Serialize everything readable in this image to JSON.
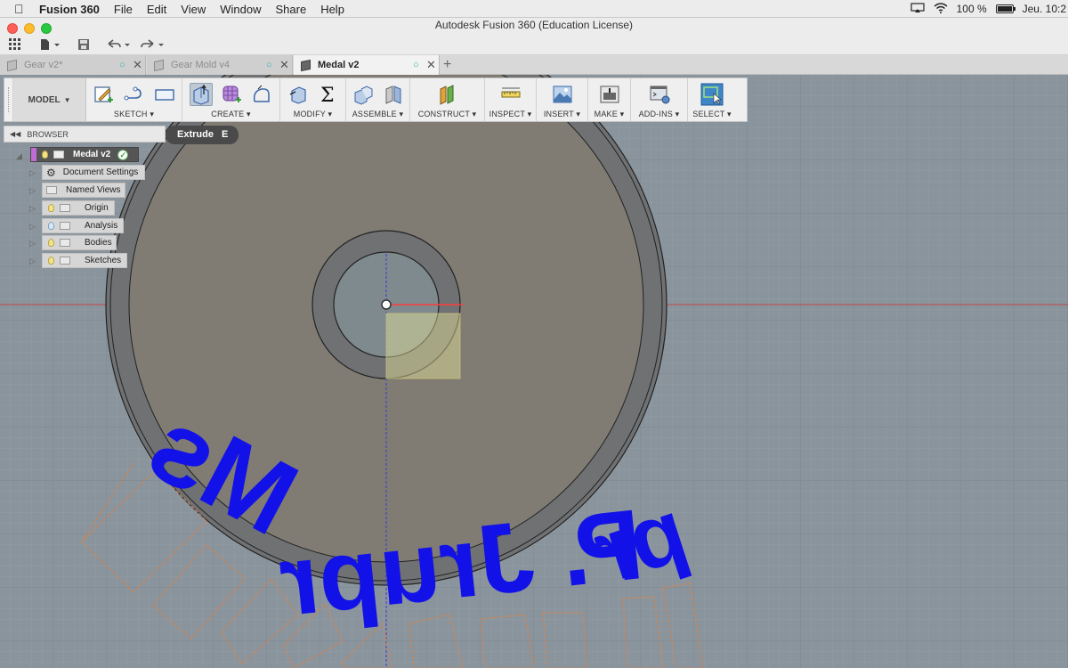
{
  "menubar": {
    "app_name": "Fusion 360",
    "menus": [
      "File",
      "Edit",
      "View",
      "Window",
      "Share",
      "Help"
    ],
    "battery": "100 %",
    "clock": "Jeu. 10:2"
  },
  "window": {
    "title": "Autodesk Fusion 360 (Education License)"
  },
  "tabs": [
    {
      "label": "Gear v2*"
    },
    {
      "label": "Gear Mold v4"
    },
    {
      "label": "Medal v2"
    }
  ],
  "toolbar": {
    "workspace": "MODEL",
    "groups": [
      {
        "label": "SKETCH"
      },
      {
        "label": "CREATE"
      },
      {
        "label": "MODIFY"
      },
      {
        "label": "ASSEMBLE"
      },
      {
        "label": "CONSTRUCT"
      },
      {
        "label": "INSPECT"
      },
      {
        "label": "INSERT"
      },
      {
        "label": "MAKE"
      },
      {
        "label": "ADD-INS"
      },
      {
        "label": "SELECT"
      }
    ]
  },
  "tooltip": {
    "label": "Extrude",
    "shortcut": "E"
  },
  "browser": {
    "title": "BROWSER",
    "root": "Medal v2",
    "items": [
      {
        "label": "Document Settings"
      },
      {
        "label": "Named Views"
      },
      {
        "label": "Origin"
      },
      {
        "label": "Analysis"
      },
      {
        "label": "Bodies"
      },
      {
        "label": "Sketches"
      }
    ]
  },
  "canvas": {
    "text_line1": "Ms",
    "text_line2": "P. Jrupr",
    "text_line3": "pr"
  },
  "colors": {
    "viewport_bg": "#8a949c",
    "body_gray": "#7d7a72",
    "text_blue": "#1414e6",
    "sketch_orange": "#d9824a"
  },
  "icons": {
    "apple": "apple-logo-icon",
    "wifi": "wifi-icon",
    "airplay": "airplay-icon"
  }
}
